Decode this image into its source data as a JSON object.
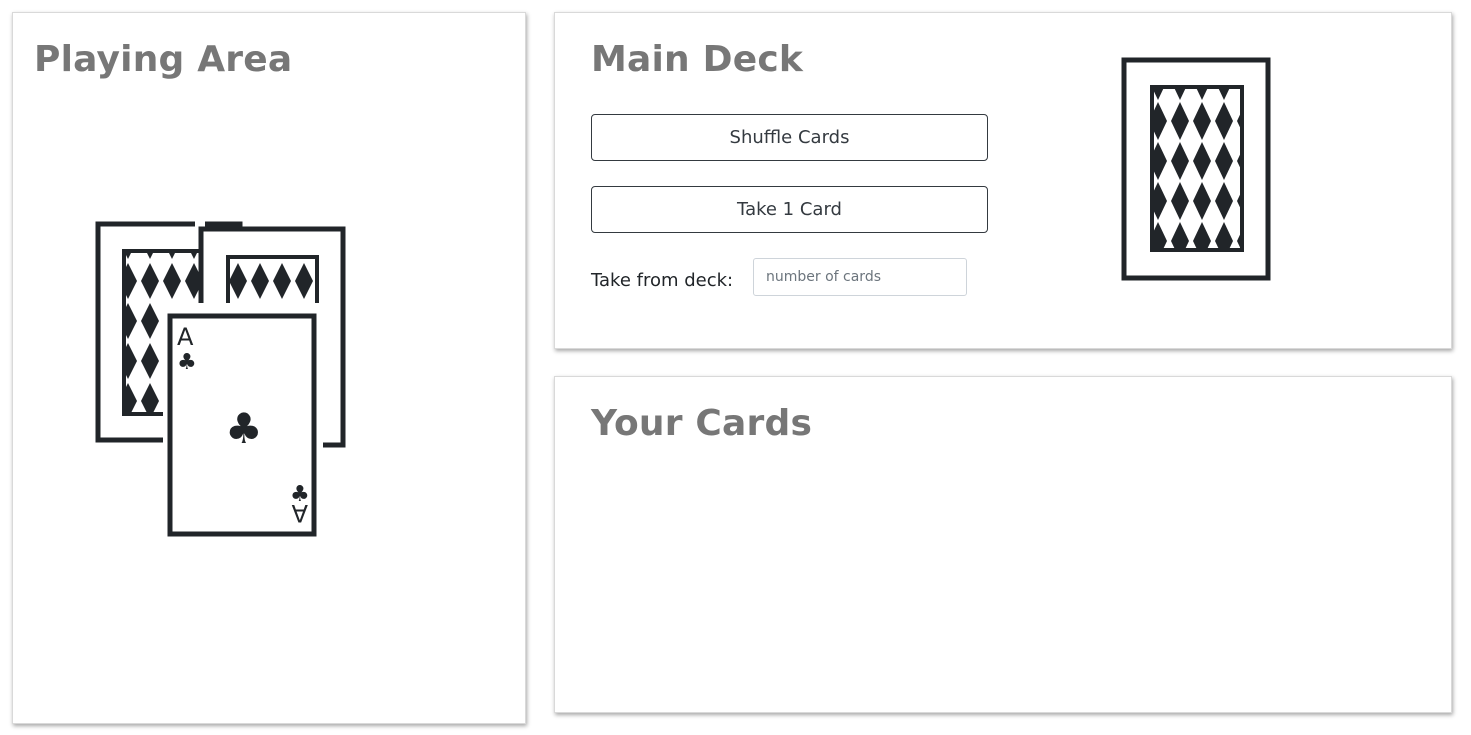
{
  "playing_area": {
    "title": "Playing Area",
    "ace_rank": "A",
    "ace_suit": "♣",
    "icon": "playing-cards-icon"
  },
  "main_deck": {
    "title": "Main Deck",
    "shuffle_label": "Shuffle Cards",
    "take_one_label": "Take 1 Card",
    "take_from_label": "Take from deck:",
    "number_placeholder": "number of cards",
    "deck_icon": "card-back-icon"
  },
  "your_cards": {
    "title": "Your Cards"
  },
  "colors": {
    "panel_title": "#777777",
    "card_ink": "#212529",
    "button_border": "#343a40"
  }
}
